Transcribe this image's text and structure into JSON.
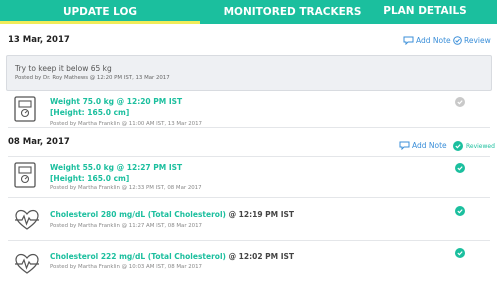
{
  "tabs": [
    {
      "label": "UPDATE LOG"
    },
    {
      "label": "MONITORED TRACKERS"
    },
    {
      "label": "PLAN DETAILS"
    }
  ],
  "sections": [
    {
      "date": "13 Mar, 2017",
      "add_note_label": "Add Note",
      "review_label": "Review",
      "note": {
        "text": "Try to keep it below 65 kg",
        "meta": "Posted by Dr. Roy Mathews @ 12:20 PM IST, 13 Mar 2017"
      },
      "entries": [
        {
          "icon": "weighing-scale-icon",
          "title": "Weight 75.0 kg @ 12:20 PM IST",
          "subtitle": "[Height: 165.0 cm]",
          "meta": "Posted by Martha Franklin @ 11:00 AM IST, 13 Mar 2017",
          "status": "pending"
        }
      ]
    },
    {
      "date": "08 Mar, 2017",
      "add_note_label": "Add Note",
      "reviewed_label": "Reviewed",
      "entries": [
        {
          "icon": "weighing-scale-icon",
          "title": "Weight 55.0 kg @ 12:27 PM IST",
          "subtitle": "[Height: 165.0 cm]",
          "meta": "Posted by Martha Franklin @ 12:33 PM IST, 08 Mar 2017",
          "status": "reviewed"
        },
        {
          "icon": "heart-pulse-icon",
          "title_main": "Cholesterol 280 mg/dL (Total Cholesterol)",
          "title_time": " @ 12:19 PM IST",
          "meta": "Posted by Martha Franklin @ 11:27 AM IST, 08 Mar 2017",
          "status": "reviewed"
        },
        {
          "icon": "heart-pulse-icon",
          "title_main": "Cholesterol 222 mg/dL (Total Cholesterol)",
          "title_time": " @ 12:02 PM IST",
          "meta": "Posted by Martha Franklin @ 10:03 AM IST, 08 Mar 2017",
          "status": "reviewed"
        }
      ]
    }
  ],
  "colors": {
    "accent": "#1bbf9e",
    "tab_underline": "#f1ec5a",
    "link": "#3b8fd9",
    "pending": "#c9c9c9"
  }
}
